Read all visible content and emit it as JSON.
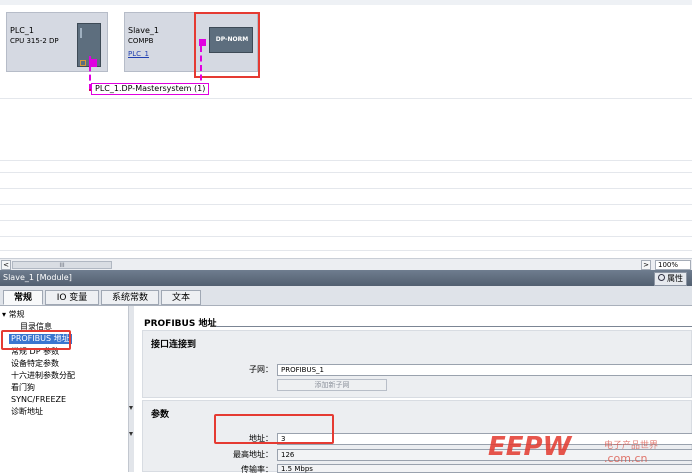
{
  "network": {
    "plc": {
      "name": "PLC_1",
      "type": "CPU 315-2 DP"
    },
    "slave": {
      "name": "Slave_1",
      "type": "COMPB",
      "link": "PLC_1",
      "module_label": "DP-NORM"
    },
    "bus_label": "PLC_1.DP-Mastersystem (1)"
  },
  "scrollbar": {
    "left_arrow": "<",
    "thumb_grip": "III",
    "right_arrow": ">",
    "zoom": "100%"
  },
  "inspector": {
    "title": "Slave_1 [Module]",
    "properties_button": "属性",
    "tabs": [
      {
        "label": "常规"
      },
      {
        "label": "IO 变量"
      },
      {
        "label": "系统常数"
      },
      {
        "label": "文本"
      }
    ],
    "nav": {
      "root": "常规",
      "items": [
        {
          "label": "目录信息"
        },
        {
          "label": "PROFIBUS 地址"
        },
        {
          "label": "常规 DP 参数"
        },
        {
          "label": "设备特定参数"
        },
        {
          "label": "十六进制参数分配"
        },
        {
          "label": "看门狗"
        },
        {
          "label": "SYNC/FREEZE"
        },
        {
          "label": "诊断地址"
        }
      ]
    },
    "content": {
      "heading": "PROFIBUS 地址",
      "interface_section": "接口连接到",
      "subnet_label": "子网：",
      "subnet_value": "PROFIBUS_1",
      "add_subnet_button": "添加新子网",
      "params_section": "参数",
      "address_label": "地址：",
      "address_value": "3",
      "highest_label": "最高地址：",
      "highest_value": "126",
      "rate_label": "传输率：",
      "rate_value": "1.5 Mbps"
    }
  },
  "watermark": {
    "logo": "EEPW",
    "cn": "电子产品世界",
    "url": ".com.cn"
  },
  "colors": {
    "bus": "#d6005a",
    "port": "#e000e0",
    "highlight": "#e53a32",
    "selection": "#3a76d0"
  }
}
